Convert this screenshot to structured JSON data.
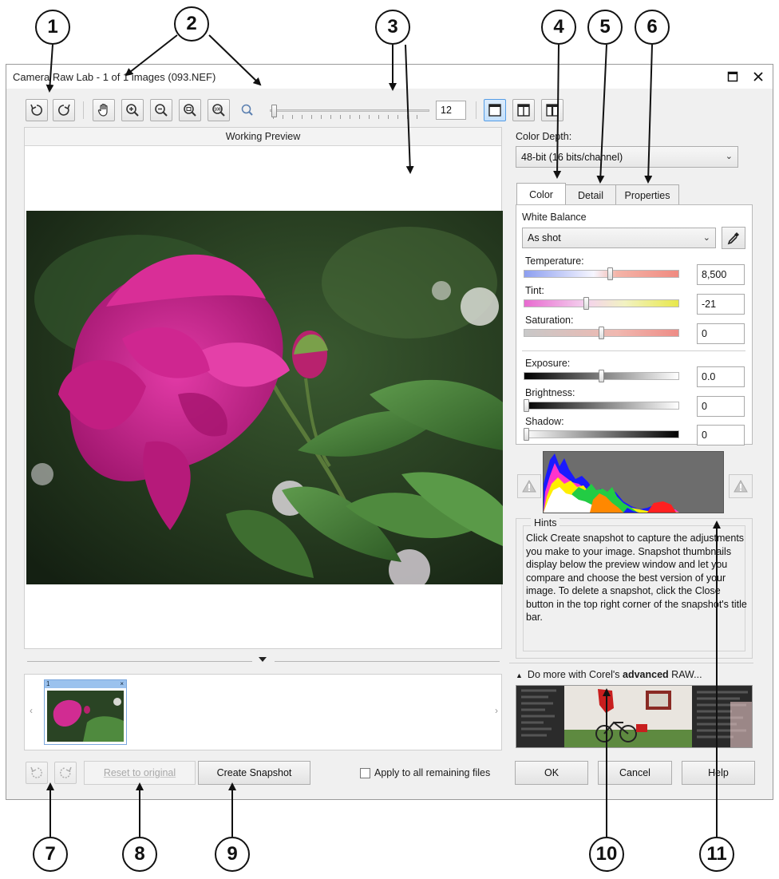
{
  "window": {
    "title": "Camera Raw Lab - 1 of 1 images (093.NEF)",
    "maximize_icon": "maximize-icon",
    "close_icon": "close-icon"
  },
  "toolbar": {
    "zoom_value": "12",
    "icons": [
      "rotate-left-icon",
      "rotate-right-icon",
      "pan-hand-icon",
      "zoom-in-icon",
      "zoom-out-icon",
      "zoom-fit-icon",
      "zoom-100-icon",
      "zoom-glass-icon",
      "single-view-icon",
      "split-view-icon",
      "side-by-side-icon"
    ]
  },
  "preview": {
    "title": "Working Preview"
  },
  "color_depth": {
    "label": "Color Depth:",
    "value": "48-bit (16 bits/channel)"
  },
  "tabs": [
    {
      "label": "Color"
    },
    {
      "label": "Detail"
    },
    {
      "label": "Properties"
    }
  ],
  "color_tab": {
    "white_balance_label": "White Balance",
    "white_balance_value": "As shot",
    "eyedropper_icon": "eyedropper-icon",
    "sliders": [
      {
        "label": "Temperature:",
        "value": "8,500",
        "level": 0.56
      },
      {
        "label": "Tint:",
        "value": "-21",
        "level": 0.4
      },
      {
        "label": "Saturation:",
        "value": "0",
        "level": 0.5
      },
      {
        "label": "Exposure:",
        "value": "0.0",
        "level": 0.5
      },
      {
        "label": "Brightness:",
        "value": "0",
        "level": 0.0
      },
      {
        "label": "Shadow:",
        "value": "0",
        "level": 0.0
      }
    ]
  },
  "histogram": {
    "left_warning_icon": "warning-icon",
    "right_warning_icon": "warning-icon"
  },
  "hints": {
    "legend": "Hints",
    "text": "Click Create snapshot to capture the adjustments you make to your image. Snapshot thumbnails display below the preview window and let you compare and choose the best version of your image. To delete a snapshot, click the Close button in the top right corner of the snapshot's title bar."
  },
  "promo": {
    "prefix": "Do more with Corel's ",
    "bold": "advanced",
    "suffix": " RAW..."
  },
  "snapshot": {
    "index": "1"
  },
  "footer": {
    "reset_label": "Reset to original",
    "snapshot_label": "Create Snapshot",
    "apply_all_label": "Apply to all remaining files",
    "ok_label": "OK",
    "cancel_label": "Cancel",
    "help_label": "Help"
  },
  "callouts": [
    "1",
    "2",
    "3",
    "4",
    "5",
    "6",
    "7",
    "8",
    "9",
    "10",
    "11"
  ]
}
